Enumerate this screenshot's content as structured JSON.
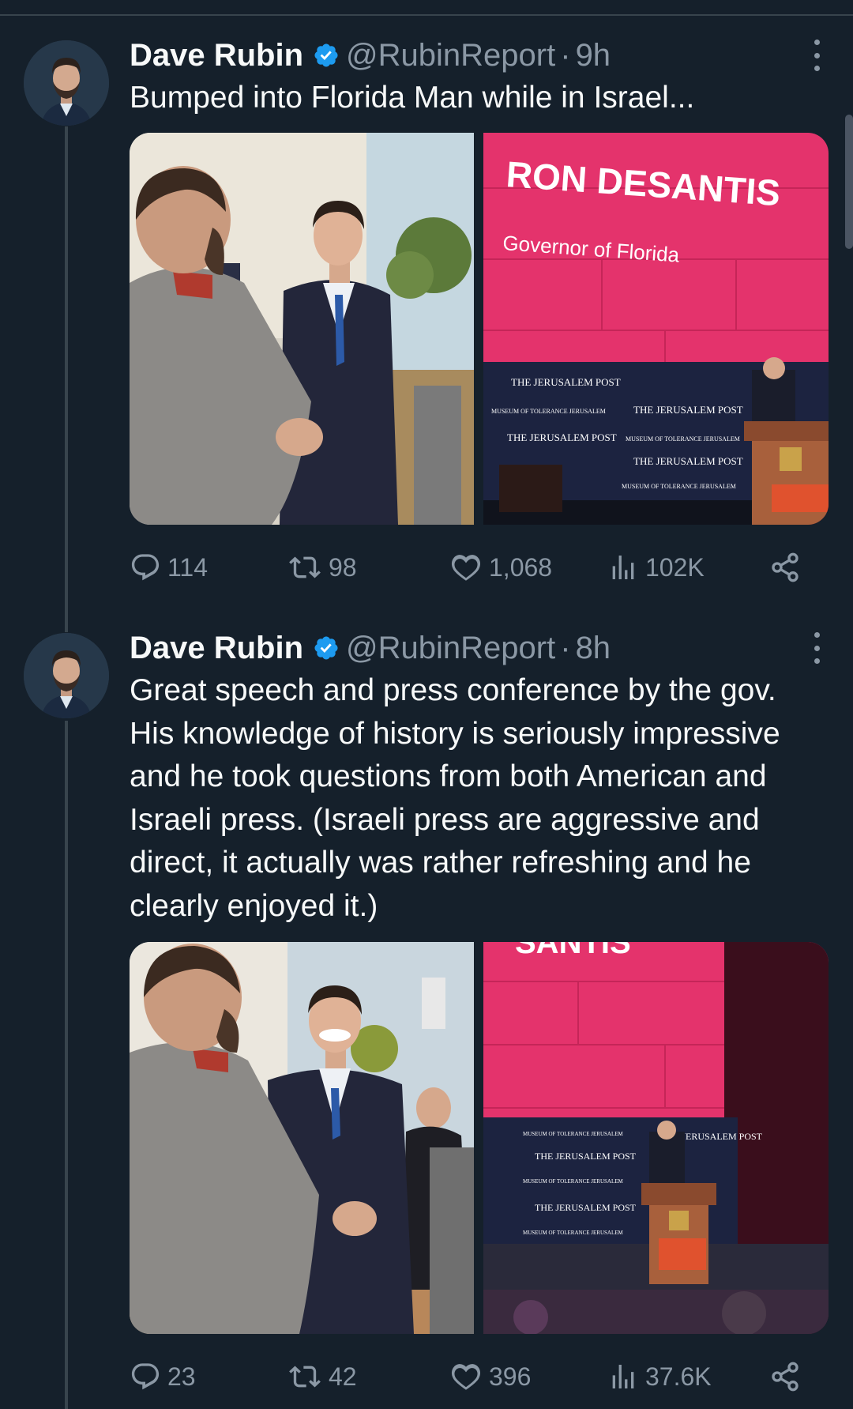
{
  "tweets": [
    {
      "author_name": "Dave Rubin",
      "handle": "@RubinReport",
      "separator": "·",
      "time": "9h",
      "text": "Bumped into Florida Man while in Israel...",
      "media": [
        {
          "screen_title": "RON DESANTIS",
          "screen_subtitle": "Governor of Florida"
        },
        {}
      ],
      "replies": "114",
      "reposts": "98",
      "likes": "1,068",
      "views": "102K"
    },
    {
      "author_name": "Dave Rubin",
      "handle": "@RubinReport",
      "separator": "·",
      "time": "8h",
      "text": "Great speech and press conference by the gov. His knowledge of history is seriously impressive and he took questions from both American and Israeli press. (Israeli press are aggressive and direct, it actually was rather refreshing and he clearly enjoyed it.)",
      "media": [
        {},
        {
          "screen_title_fragment": "SANTIS"
        }
      ],
      "replies": "23",
      "reposts": "42",
      "likes": "396",
      "views": "37.6K"
    }
  ],
  "backdrop_brands": [
    "THE JERUSALEM POST",
    "MUSEUM OF TOLERANCE JERUSALEM"
  ],
  "colors": {
    "background": "#15202b",
    "text": "#f7f9f9",
    "muted": "#8b98a5",
    "verified": "#1d9bf0",
    "thread_line": "#38444d",
    "stage_pink": "#e4336c",
    "backdrop_navy": "#1c2340"
  }
}
